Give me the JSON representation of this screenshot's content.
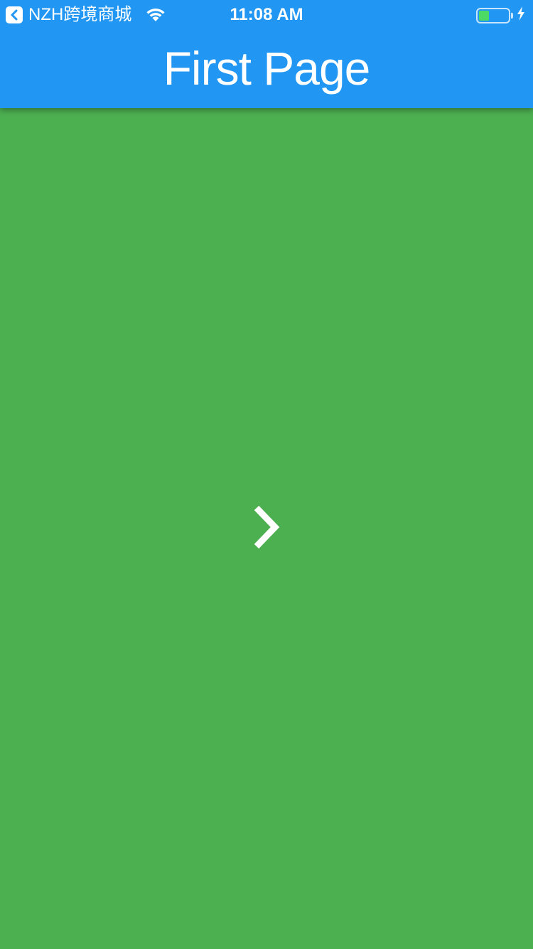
{
  "status_bar": {
    "back_app_label": "NZH跨境商城",
    "time": "11:08 AM",
    "battery_level": 0.35
  },
  "app_bar": {
    "title": "First Page",
    "color": "#2196F3"
  },
  "content": {
    "background_color": "#4CAF50",
    "next_icon": "chevron-right-icon"
  }
}
